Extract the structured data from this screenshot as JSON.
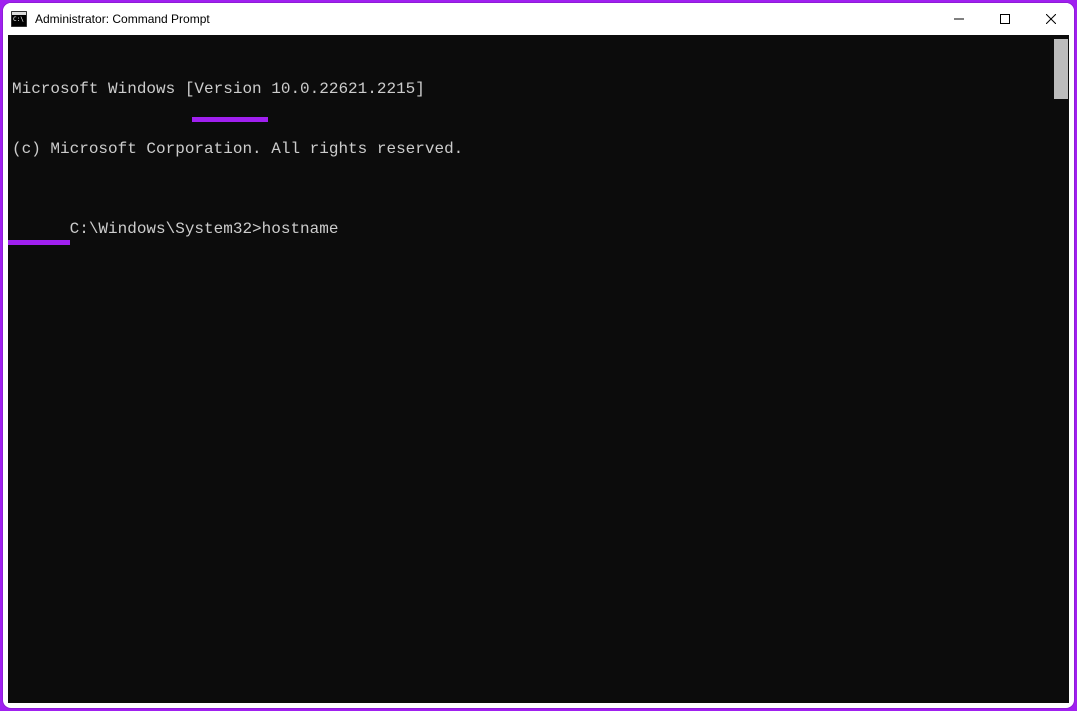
{
  "window": {
    "title": "Administrator: Command Prompt"
  },
  "terminal": {
    "line1": "Microsoft Windows [Version 10.0.22621.2215]",
    "line2": "(c) Microsoft Corporation. All rights reserved.",
    "blank": "",
    "prompt": "C:\\Windows\\System32>",
    "command": "hostname"
  },
  "colors": {
    "accent": "#a020f0",
    "terminal_bg": "#0c0c0c",
    "terminal_fg": "#cccccc"
  }
}
